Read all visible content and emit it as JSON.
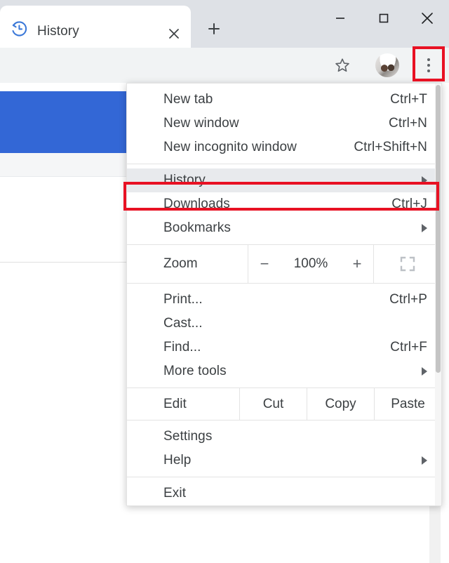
{
  "window": {
    "controls": [
      {
        "name": "minimize",
        "glyph": "minimize-icon"
      },
      {
        "name": "maximize",
        "glyph": "maximize-icon"
      },
      {
        "name": "close",
        "glyph": "close-icon"
      }
    ]
  },
  "tabstrip": {
    "tab": {
      "title": "History",
      "favicon": "history-clock-icon",
      "close_label": "close-tab-icon"
    },
    "new_tab_label": "new-tab-icon"
  },
  "toolbar": {
    "bookmark_icon": "star-icon",
    "avatar_label": "profile-avatar",
    "menu_icon": "three-dot-menu-icon"
  },
  "menu": {
    "sections": [
      {
        "items": [
          {
            "label": "New tab",
            "accel": "Ctrl+T",
            "submenu": false,
            "highlight": false
          },
          {
            "label": "New window",
            "accel": "Ctrl+N",
            "submenu": false,
            "highlight": false
          },
          {
            "label": "New incognito window",
            "accel": "Ctrl+Shift+N",
            "submenu": false,
            "highlight": false
          }
        ]
      },
      {
        "items": [
          {
            "label": "History",
            "accel": "",
            "submenu": true,
            "highlight": true
          },
          {
            "label": "Downloads",
            "accel": "Ctrl+J",
            "submenu": false,
            "highlight": false
          },
          {
            "label": "Bookmarks",
            "accel": "",
            "submenu": true,
            "highlight": false
          }
        ]
      },
      {
        "items": [
          {
            "label": "Print...",
            "accel": "Ctrl+P",
            "submenu": false,
            "highlight": false
          },
          {
            "label": "Cast...",
            "accel": "",
            "submenu": false,
            "highlight": false
          },
          {
            "label": "Find...",
            "accel": "Ctrl+F",
            "submenu": false,
            "highlight": false
          },
          {
            "label": "More tools",
            "accel": "",
            "submenu": true,
            "highlight": false
          }
        ]
      },
      {
        "items": [
          {
            "label": "Settings",
            "accel": "",
            "submenu": false,
            "highlight": false
          },
          {
            "label": "Help",
            "accel": "",
            "submenu": true,
            "highlight": false
          }
        ]
      },
      {
        "items": [
          {
            "label": "Exit",
            "accel": "",
            "submenu": false,
            "highlight": false
          }
        ]
      }
    ],
    "zoom_row": {
      "label": "Zoom",
      "minus": "−",
      "value": "100%",
      "plus": "+",
      "fullscreen_icon": "fullscreen-icon"
    },
    "edit_row": {
      "label": "Edit",
      "actions": [
        "Cut",
        "Copy",
        "Paste"
      ]
    }
  },
  "highlights": {
    "color": "#e81123",
    "targets": [
      "three-dot-menu-button",
      "history-menu-item"
    ]
  },
  "colors": {
    "tabstrip_bg": "#dee1e6",
    "toolbar_bg": "#f1f3f4",
    "menu_bg": "#ffffff",
    "menu_highlight": "#e8eaed",
    "page_banner": "#3367d6",
    "text": "#3c4043",
    "accent_red": "#e81123"
  }
}
